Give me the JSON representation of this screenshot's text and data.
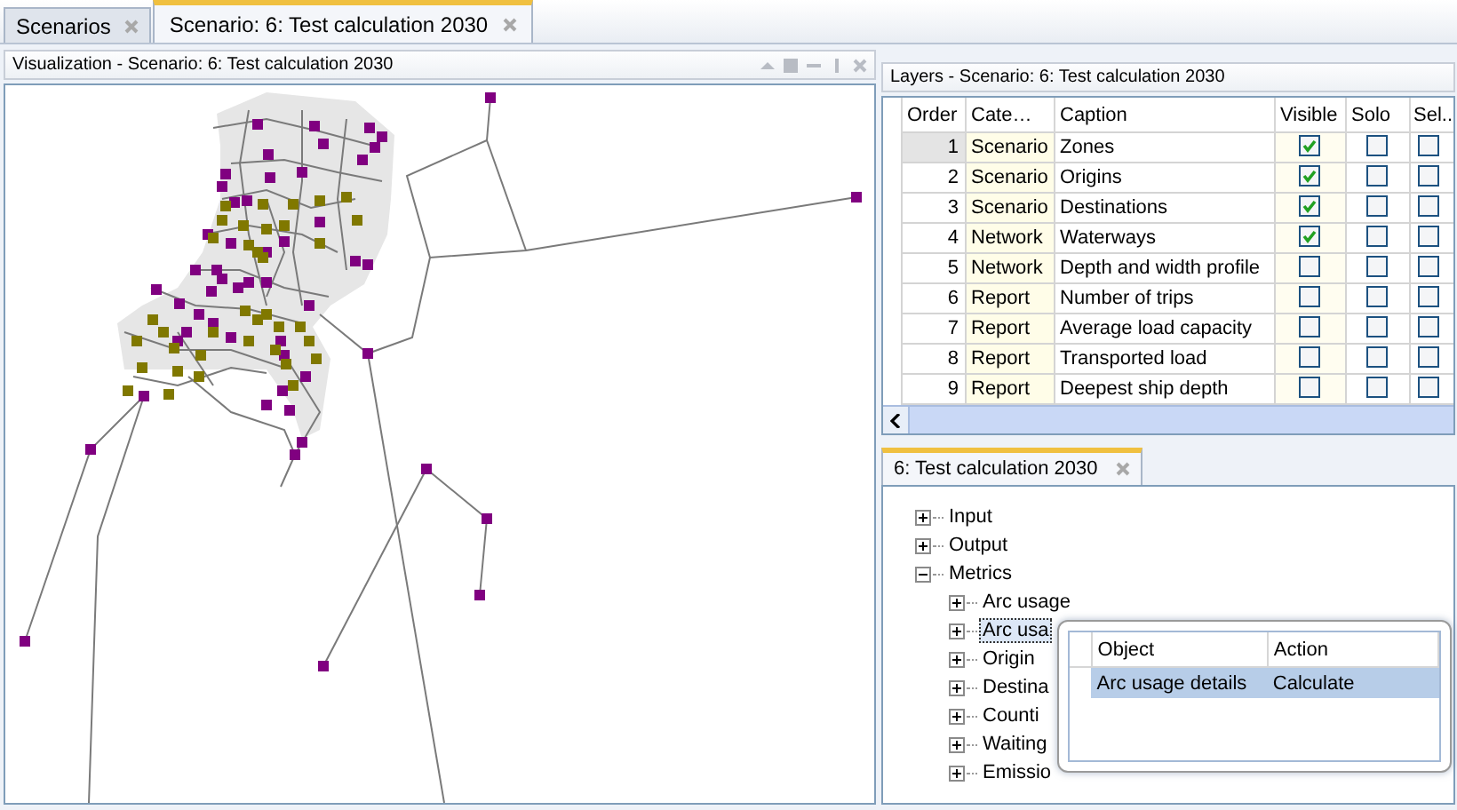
{
  "tabs": [
    {
      "label": "Scenarios",
      "selected": false
    },
    {
      "label": "Scenario: 6: Test calculation 2030",
      "selected": true
    }
  ],
  "visualization": {
    "title": "Visualization - Scenario: 6: Test calculation 2030"
  },
  "layers": {
    "title": "Layers - Scenario: 6: Test calculation 2030",
    "columns": [
      "Order",
      "Cate…",
      "Caption",
      "Visible",
      "Solo",
      "Sel.."
    ],
    "rows": [
      {
        "order": "1",
        "category": "Scenario",
        "caption": "Zones",
        "visible": true,
        "solo": false,
        "sel": false,
        "selected": true
      },
      {
        "order": "2",
        "category": "Scenario",
        "caption": "Origins",
        "visible": true,
        "solo": false,
        "sel": false,
        "selected": false
      },
      {
        "order": "3",
        "category": "Scenario",
        "caption": "Destinations",
        "visible": true,
        "solo": false,
        "sel": false,
        "selected": false
      },
      {
        "order": "4",
        "category": "Network",
        "caption": "Waterways",
        "visible": true,
        "solo": false,
        "sel": false,
        "selected": false
      },
      {
        "order": "5",
        "category": "Network",
        "caption": "Depth and width profile",
        "visible": false,
        "solo": false,
        "sel": false,
        "selected": false
      },
      {
        "order": "6",
        "category": "Report",
        "caption": "Number of trips",
        "visible": false,
        "solo": false,
        "sel": false,
        "selected": false
      },
      {
        "order": "7",
        "category": "Report",
        "caption": "Average load capacity",
        "visible": false,
        "solo": false,
        "sel": false,
        "selected": false
      },
      {
        "order": "8",
        "category": "Report",
        "caption": "Transported load",
        "visible": false,
        "solo": false,
        "sel": false,
        "selected": false
      },
      {
        "order": "9",
        "category": "Report",
        "caption": "Deepest ship depth",
        "visible": false,
        "solo": false,
        "sel": false,
        "selected": false
      }
    ]
  },
  "details": {
    "tab": {
      "label": "6: Test calculation 2030",
      "selected": true
    },
    "tree": [
      {
        "label": "Input",
        "expanded": false,
        "selected": false
      },
      {
        "label": "Output",
        "expanded": false,
        "selected": false
      },
      {
        "label": "Metrics",
        "expanded": true,
        "selected": false,
        "children": [
          {
            "label": "Arc usage",
            "expanded": false,
            "selected": false
          },
          {
            "label": "Arc usa",
            "expanded": false,
            "selected": true
          },
          {
            "label": "Origin",
            "expanded": false,
            "selected": false
          },
          {
            "label": "Destina",
            "expanded": false,
            "selected": false
          },
          {
            "label": "Counti",
            "expanded": false,
            "selected": false
          },
          {
            "label": "Waiting",
            "expanded": false,
            "selected": false
          },
          {
            "label": "Emissio",
            "expanded": false,
            "selected": false
          }
        ]
      }
    ]
  },
  "popup": {
    "columns": [
      "Object",
      "Action"
    ],
    "rows": [
      {
        "object": "Arc usage details",
        "action": "Calculate",
        "selected": true
      }
    ]
  }
}
